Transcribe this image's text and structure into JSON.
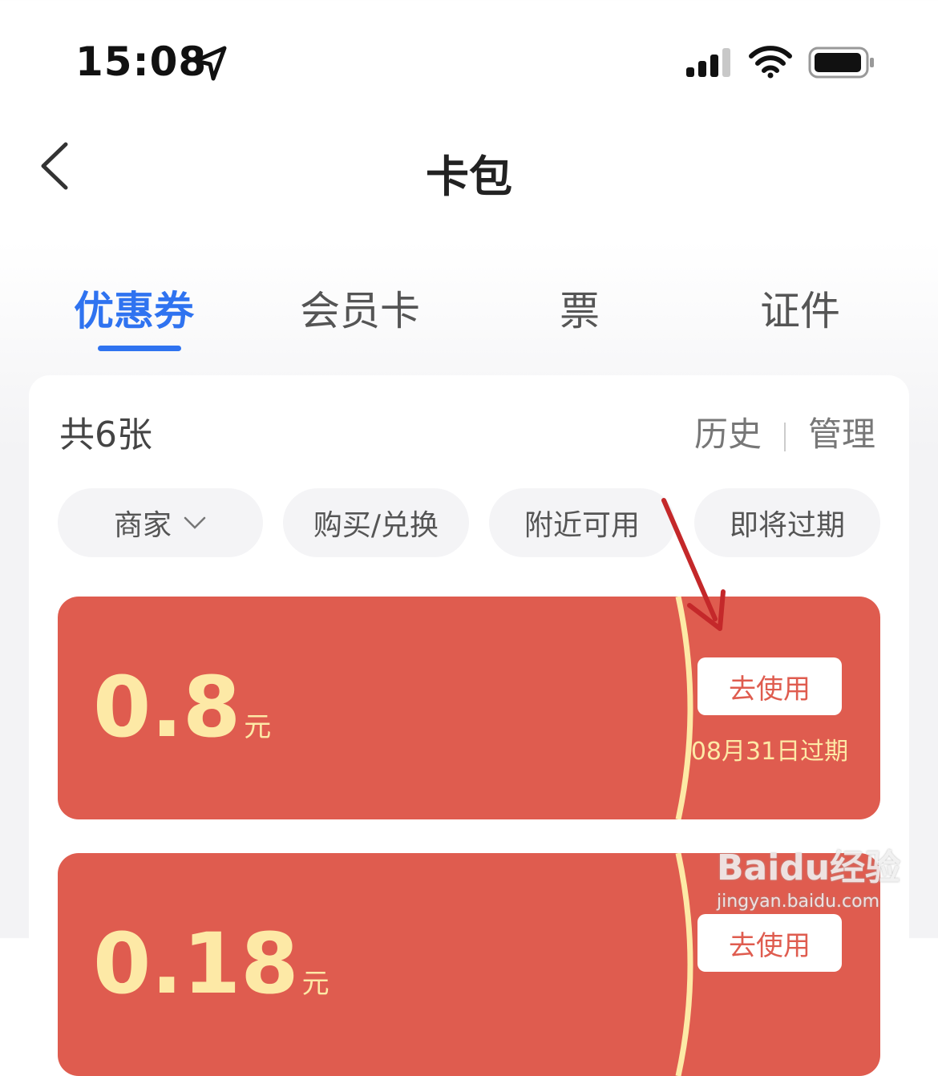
{
  "status_bar": {
    "time": "15:08"
  },
  "nav": {
    "title": "卡包"
  },
  "tabs": [
    {
      "label": "优惠券",
      "active": true
    },
    {
      "label": "会员卡",
      "active": false
    },
    {
      "label": "票",
      "active": false
    },
    {
      "label": "证件",
      "active": false
    }
  ],
  "summary": {
    "count": "共6张",
    "history": "历史",
    "manage": "管理"
  },
  "filters": [
    "商家",
    "购买/兑换",
    "附近可用",
    "即将过期"
  ],
  "coupons": [
    {
      "amount": "0.8",
      "unit": "元",
      "action": "去使用",
      "expire": "08月31日过期"
    },
    {
      "amount": "0.18",
      "unit": "元",
      "action": "去使用",
      "expire": ""
    }
  ],
  "colors": {
    "accent": "#2f73f0",
    "coupon": "#df5c4f",
    "coupon_text": "#fde9a6",
    "annotation_arrow": "#c4282a"
  },
  "watermark": {
    "logo": "Baidu经验",
    "url": "jingyan.baidu.com"
  }
}
